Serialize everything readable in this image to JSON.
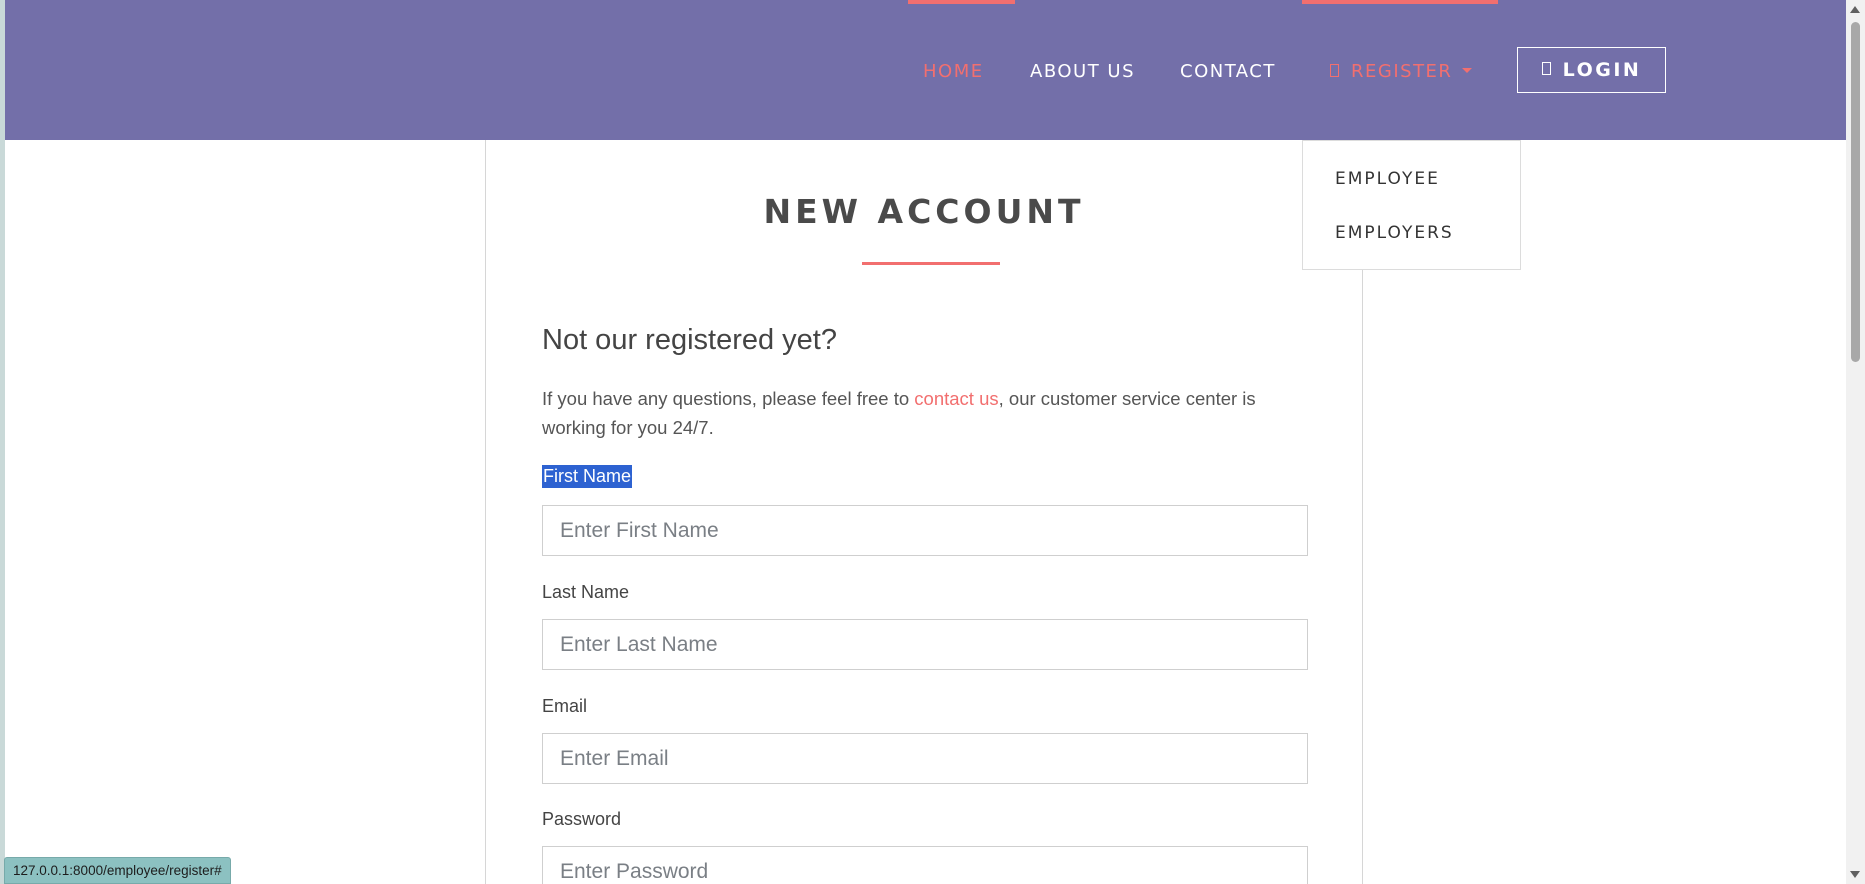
{
  "nav": {
    "home": "HOME",
    "about": "ABOUT US",
    "contact": "CONTACT",
    "register": "REGISTER",
    "login": "LOGIN"
  },
  "dropdown": {
    "items": [
      "EMPLOYEE",
      "EMPLOYERS"
    ]
  },
  "main": {
    "title": "NEW ACCOUNT",
    "subtitle": "Not our registered yet?",
    "intro_before": "If you have any questions, please feel free to ",
    "intro_link": "contact us",
    "intro_after": ", our customer service center is working for you 24/7."
  },
  "form": {
    "first_name_label": "First Name",
    "first_name_placeholder": "Enter First Name",
    "last_name_label": "Last Name",
    "last_name_placeholder": "Enter Last Name",
    "email_label": "Email",
    "email_placeholder": "Enter Email",
    "password_label": "Password",
    "password_placeholder": "Enter Password"
  },
  "status": {
    "url": "127.0.0.1:8000/employee/register#"
  },
  "colors": {
    "header_bg": "#736fa9",
    "accent": "#f26f6f",
    "selection": "#2d62d1"
  }
}
